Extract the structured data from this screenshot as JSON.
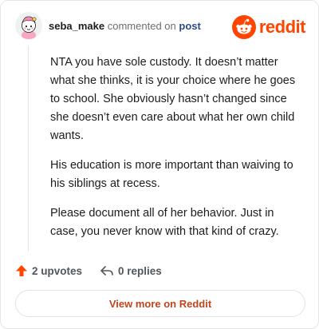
{
  "comment": {
    "username": "seba_make",
    "commented_on_text": "commented on",
    "post_link_text": "post",
    "paragraphs": [
      "NTA you have sole custody. It doesn’t matter what she thinks, it is your choice where he goes to school. She obviously hasn’t changed since she doesn’t even care about what her own child wants.",
      "His education is more important than waiving to his siblings at recess.",
      "Please document all of her behavior. Just in case, you never know with that kind of crazy."
    ]
  },
  "brand": {
    "logo_text": "reddit",
    "accent_color": "#ff4500"
  },
  "actions": {
    "upvotes_label": "2 upvotes",
    "replies_label": "0 replies",
    "upvote_icon": "upvote-arrow-icon",
    "reply_icon": "reply-arrow-icon"
  },
  "footer": {
    "view_more_label": "View more on Reddit",
    "link_color": "#c0451c"
  }
}
